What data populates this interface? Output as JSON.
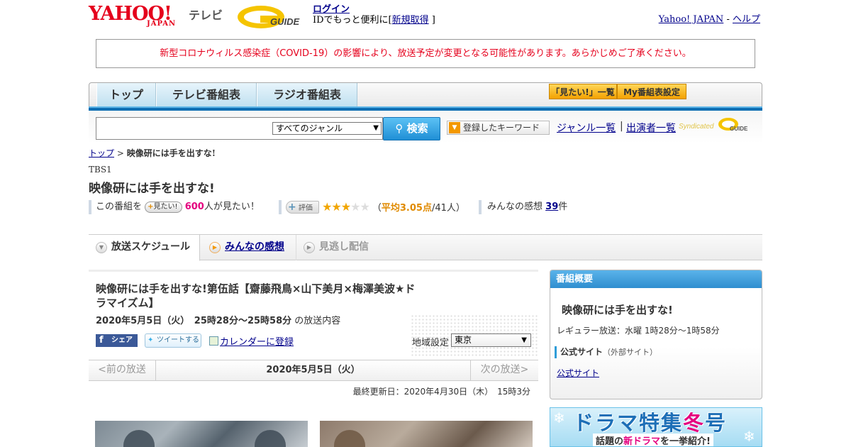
{
  "header": {
    "yahoo_logo": "YAHOO!",
    "yahoo_sub": "JAPAN",
    "tv_label": "テレビ",
    "guide_logo": "GUIDE",
    "login": "ログイン",
    "id_text_prefix": "IDでもっと便利に[",
    "register": "新規取得",
    "id_text_suffix": "]",
    "yahoo_japan": "Yahoo! JAPAN",
    "sep": "-",
    "help": "ヘルプ"
  },
  "notice": "新型コロナウィルス感染症（COVID-19）の影響により、放送予定が変更となる可能性があります。あらかじめご了承ください。",
  "nav": {
    "tabs": [
      "トップ",
      "テレビ番組表",
      "ラジオ番組表"
    ],
    "mitai_list": "「見たい!」一覧",
    "my_settings": "My番組表設定"
  },
  "search": {
    "placeholder": "",
    "genre": "すべてのジャンル",
    "button": "検索",
    "keyword_button": "登録したキーワード",
    "genre_list": "ジャンル一覧",
    "sep": "|",
    "performer_list": "出演者一覧",
    "syndicated": "Syndicated"
  },
  "breadcrumb": {
    "top": "トップ",
    "sep": ">",
    "current": "映像研には手を出すな!"
  },
  "program": {
    "channel": "TBS1",
    "title": "映像研には手を出すな!",
    "stat_prefix": "この番組を",
    "mitai_badge": "見たい!",
    "mitai_count": "600",
    "mitai_suffix": "人が見たい！",
    "eval_badge": "評価",
    "rating_value": 3.05,
    "rating_open": "（",
    "rating_avg": "平均3.05点",
    "rating_rest": "/41人）",
    "kanso_prefix": "みんなの感想",
    "kanso_count": "39",
    "kanso_suffix": "件"
  },
  "subtabs": {
    "schedule": "放送スケジュール",
    "kanso": "みんなの感想",
    "minogashi": "見逃し配信"
  },
  "episode": {
    "title": "映像研には手を出すな!第伍話【齋藤飛鳥×山下美月×梅澤美波★ドラマイズム】",
    "date_time": "2020年5月5日（火）　25時28分～25時58分",
    "date_suffix": "の放送内容",
    "share_fb": "シェア",
    "share_tw": "ツイートする",
    "calendar": "カレンダーに登録",
    "region_label": "地域設定",
    "region": "東京"
  },
  "datenav": {
    "prev": "<前の放送",
    "current": "2020年5月5日（火）",
    "next": "次の放送>"
  },
  "updated": "最終更新日：2020年4月30日（木）　15時3分",
  "sidebar": {
    "heading": "番組概要",
    "title": "映像研には手を出すな!",
    "regular": "レギュラー放送：水曜 1時28分～1時58分",
    "official_head": "公式サイト",
    "official_ext": "（外部サイト）",
    "official_link": "公式サイト"
  },
  "banner": {
    "main_a": "ドラマ特集",
    "main_b": "冬",
    "main_c": "号",
    "sub_a": "話題の",
    "sub_b": "新ドラマ",
    "sub_c": "を一挙紹介!"
  },
  "colors": {
    "accent_red": "#e5001c",
    "nav_blue": "#0f6fb3",
    "pink": "#e4007f",
    "star": "#f1a600"
  }
}
